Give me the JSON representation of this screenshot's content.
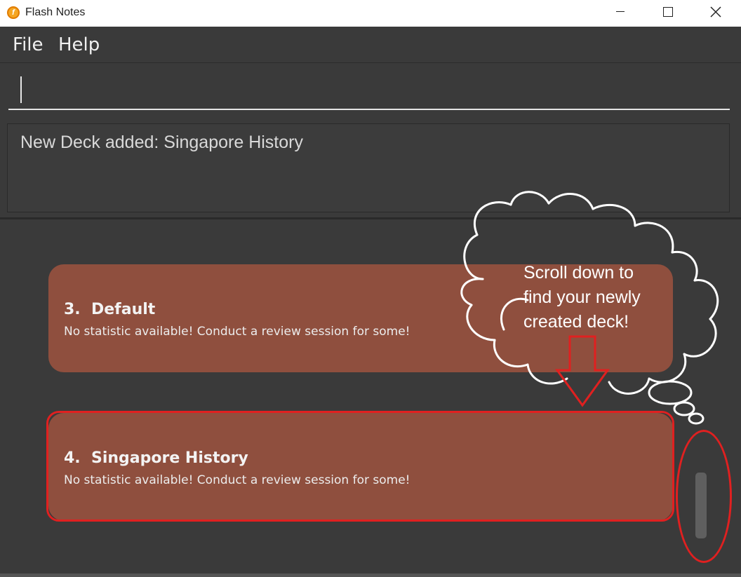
{
  "window": {
    "title": "Flash Notes",
    "app_icon": "flash-notes-logo",
    "app_icon_glyph": "f"
  },
  "menu": {
    "file_label": "File",
    "help_label": "Help"
  },
  "command": {
    "value": ""
  },
  "result": {
    "message": "New Deck added: Singapore History"
  },
  "decks": [
    {
      "index": "3.",
      "name": "Default",
      "stats": "No statistic available! Conduct a review session for some!"
    },
    {
      "index": "4.",
      "name": "Singapore History",
      "stats": "No statistic available! Conduct a review session for some!"
    }
  ],
  "annotation": {
    "callout_lines": [
      "Scroll down to",
      "find your newly",
      "created deck!"
    ]
  },
  "colors": {
    "background": "#3a3a3a",
    "deck_card": "#8f4f3e",
    "annotation_red": "#e02020"
  }
}
